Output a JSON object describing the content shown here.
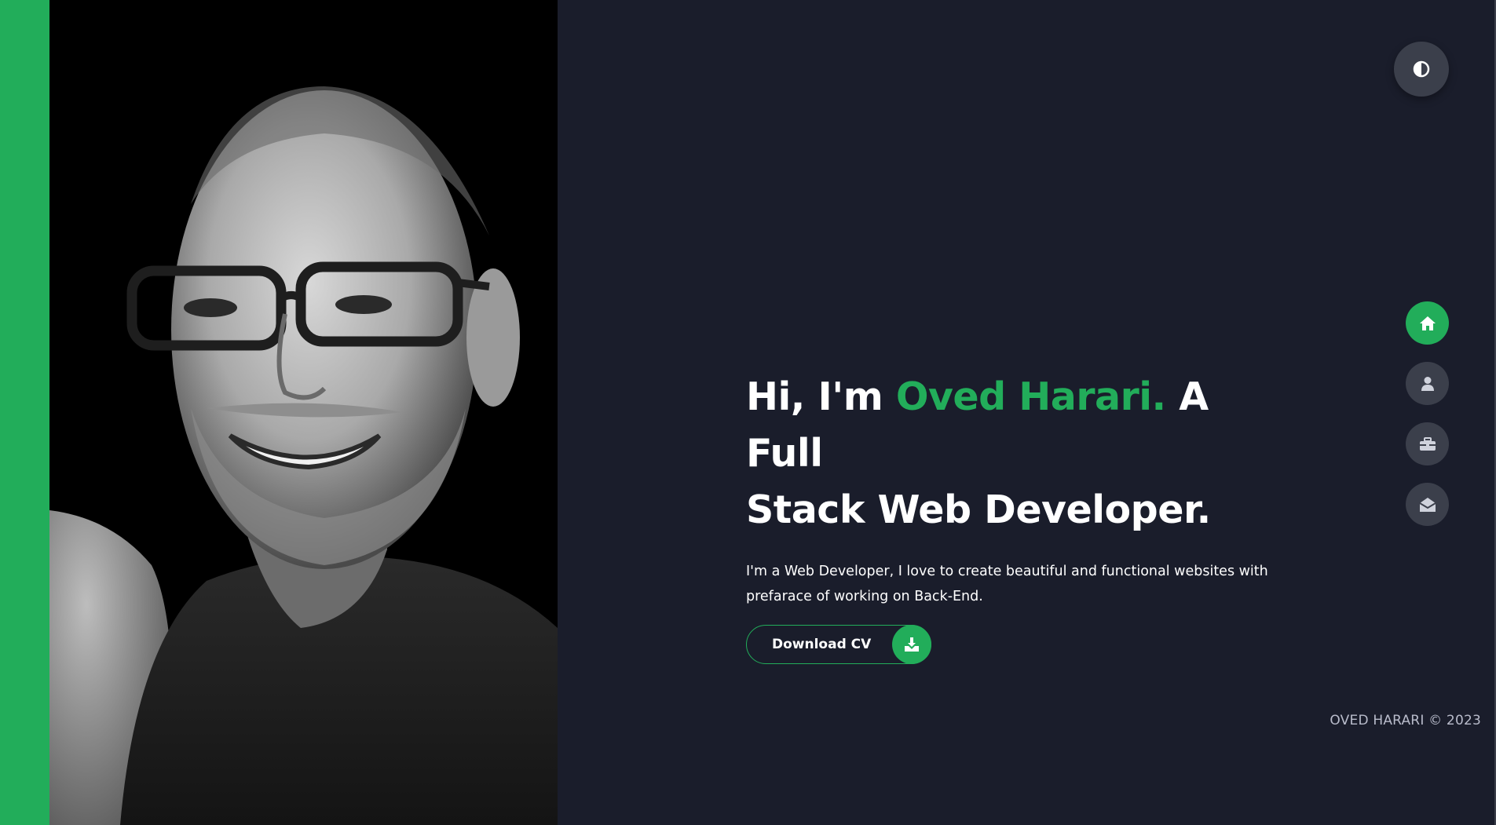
{
  "colors": {
    "accent": "#22ad5a",
    "background": "#1a1d2b",
    "button_bg": "#3b3f4b",
    "text": "#ffffff",
    "footer_text": "#b9bccb"
  },
  "theme_toggle": {
    "icon": "contrast-icon"
  },
  "nav": {
    "items": [
      {
        "id": "home",
        "icon": "home-icon",
        "active": true
      },
      {
        "id": "about",
        "icon": "user-icon",
        "active": false
      },
      {
        "id": "portfolio",
        "icon": "briefcase-icon",
        "active": false
      },
      {
        "id": "contact",
        "icon": "envelope-open-icon",
        "active": false
      }
    ]
  },
  "hero": {
    "greeting": "Hi, I'm ",
    "name": "Oved Harari.",
    "title_line1_rest": " A Full",
    "title_line2": "Stack Web Developer.",
    "description": "I'm a Web Developer, I love to create beautiful and functional websites with prefarace of working on Back-End.",
    "cv_button": {
      "label": "Download CV",
      "icon": "download-icon"
    }
  },
  "photo": {
    "description_icon": "profile-photo"
  },
  "footer": {
    "text": "OVED HARARI © 2023"
  }
}
